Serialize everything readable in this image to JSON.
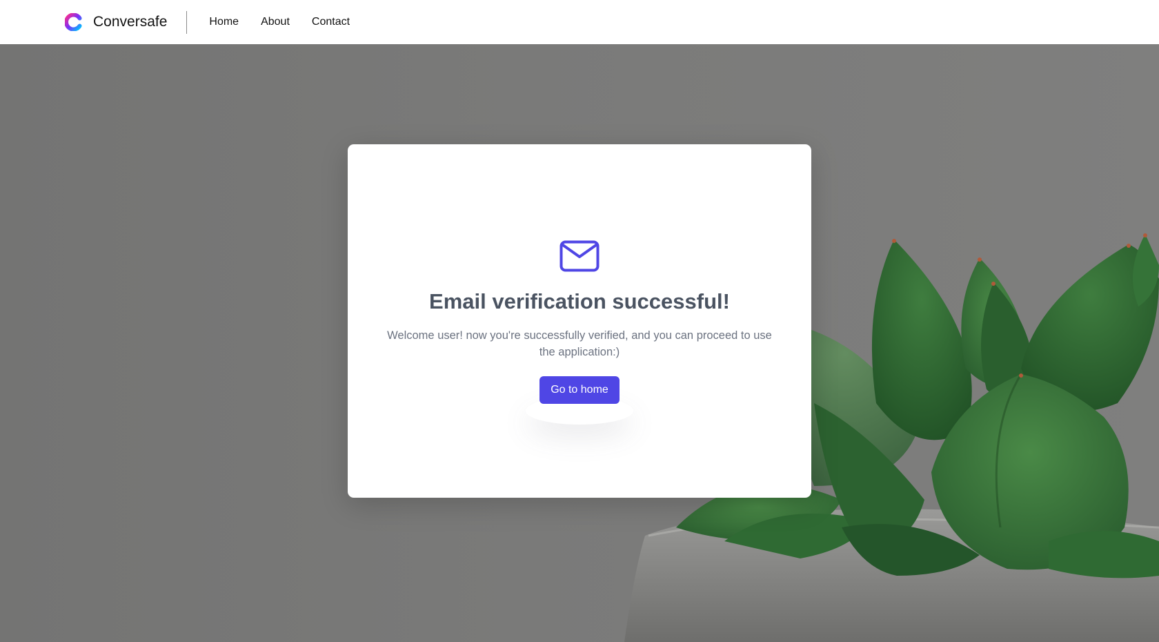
{
  "app": {
    "name": "Conversafe",
    "logo_icon": "conversafe-logo-icon"
  },
  "nav": {
    "links": [
      {
        "label": "Home"
      },
      {
        "label": "About"
      },
      {
        "label": "Contact"
      }
    ]
  },
  "verification": {
    "icon": "envelope-icon",
    "title": "Email verification successful!",
    "message": "Welcome user! now you're successfully verified, and you can proceed to use the application:)",
    "button_label": "Go to home"
  },
  "colors": {
    "accent": "#4f46e5",
    "title_text": "#4a5361",
    "body_text": "#6b7280",
    "header_bg": "#ffffff",
    "backdrop": "#7a7a79",
    "plant_green": "#2f6a33"
  }
}
